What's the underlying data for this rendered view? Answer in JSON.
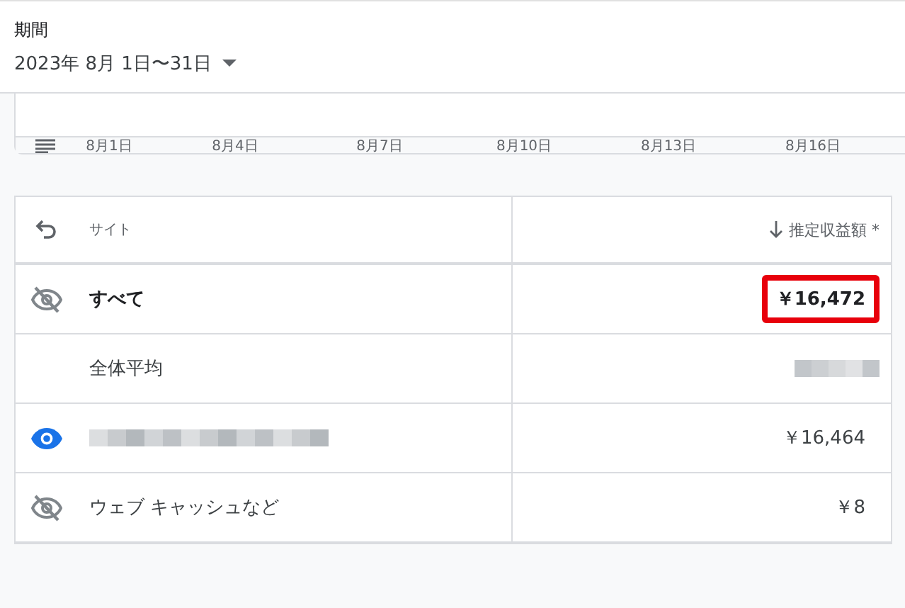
{
  "period": {
    "label": "期間",
    "value": "2023年 8月 1日〜31日"
  },
  "chart": {
    "axis_labels": [
      "8月1日",
      "8月4日",
      "8月7日",
      "8月10日",
      "8月13日",
      "8月16日"
    ]
  },
  "table": {
    "columns": [
      {
        "label": "サイト"
      },
      {
        "label": "推定収益額 *",
        "sorted": true
      }
    ],
    "rows": [
      {
        "kind": "total",
        "name": "すべて",
        "visible": false,
        "value": "￥16,472",
        "highlighted": true
      },
      {
        "kind": "average",
        "name": "全体平均",
        "value_redacted": true
      },
      {
        "kind": "site",
        "name_redacted": true,
        "visible": true,
        "value": "￥16,464"
      },
      {
        "kind": "site",
        "name": "ウェブ キャッシュなど",
        "visible": false,
        "value": "￥8"
      }
    ]
  }
}
